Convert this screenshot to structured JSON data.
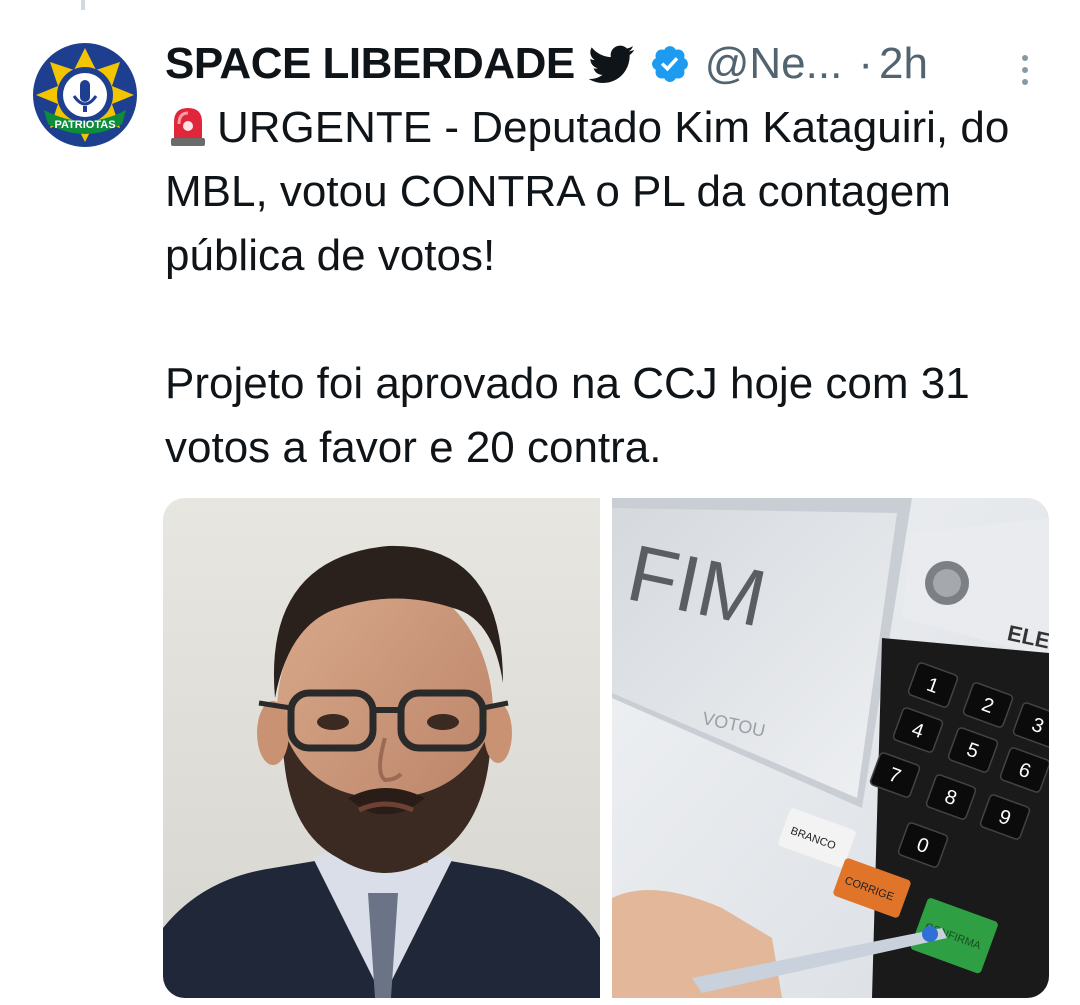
{
  "tweet": {
    "author": {
      "name": "SPACE LIBERDADE",
      "handle": "@Ne...",
      "avatar_text": "PATRIOTAS"
    },
    "separator": "·",
    "time": "2h",
    "text_line1": "URGENTE - Deputado Kim Kataguiri, do MBL, votou CONTRA o PL da contagem pública de votos!",
    "text_line2": "Projeto foi aprovado na CCJ hoje com 31 votos a favor e 20 contra.",
    "media": {
      "screen_text": "FIM",
      "screen_subtext": "VOTOU",
      "panel_label": "ELE",
      "keys": [
        "1",
        "2",
        "3",
        "4",
        "5",
        "6",
        "7",
        "8",
        "9",
        "0"
      ],
      "branco": "BRANCO",
      "corrige": "CORRIGE",
      "confirma": "CONFIRMA"
    }
  },
  "colors": {
    "verified": "#1d9bf0",
    "muted": "#536471",
    "siren": "#e0263b",
    "avatar_blue": "#1e3f8f",
    "avatar_yellow": "#f2c500",
    "avatar_green": "#0d8c3b"
  },
  "icons": {
    "bird": "twitter-bird-icon",
    "verified": "verified-badge-icon",
    "more": "more-options-icon",
    "siren": "police-siren-emoji"
  }
}
